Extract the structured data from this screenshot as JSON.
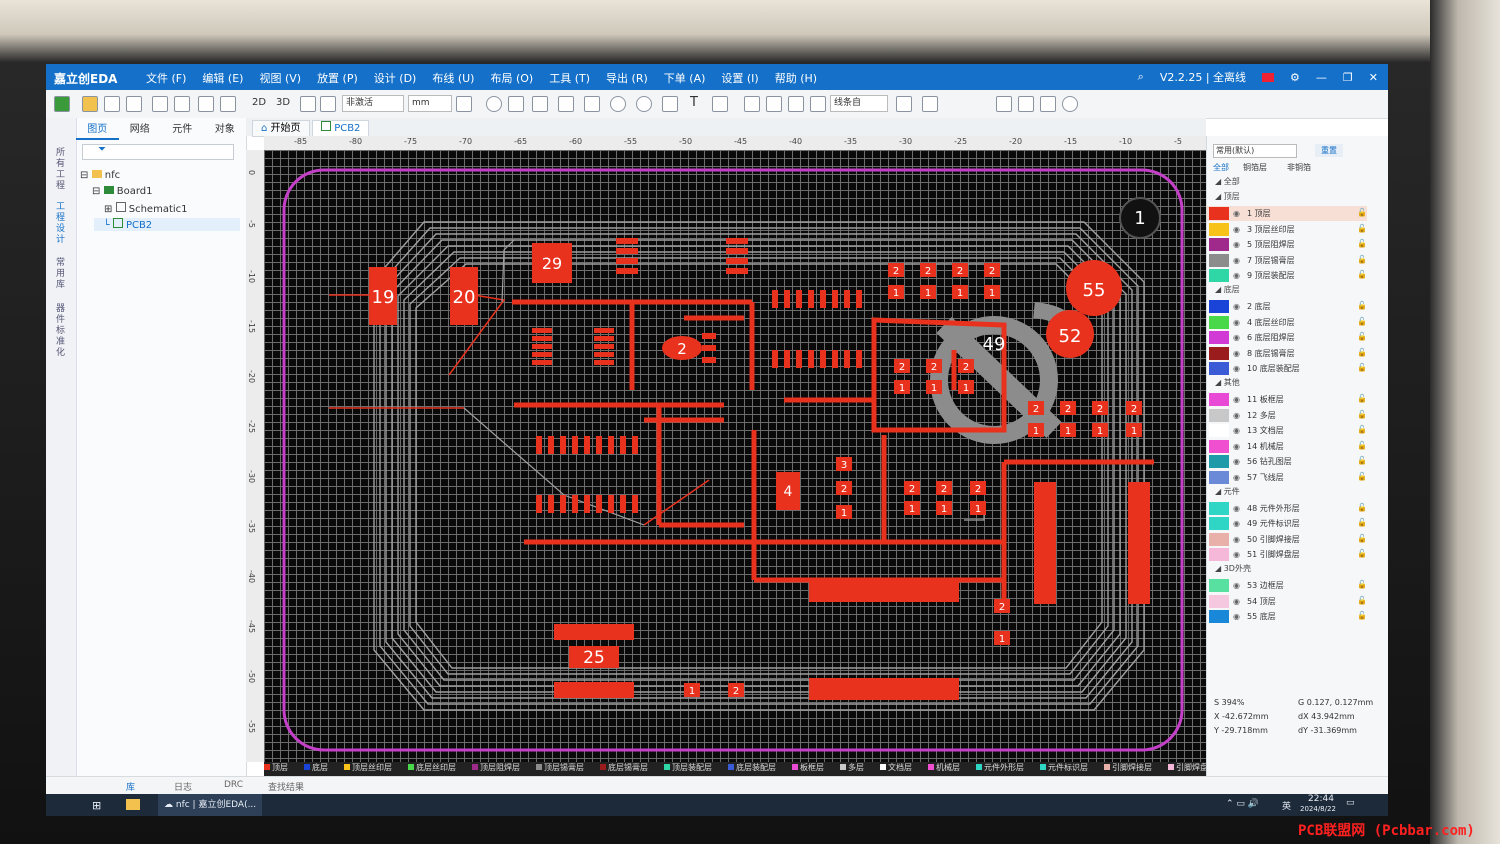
{
  "app": {
    "logo_text": "嘉立创EDA",
    "version": "V2.2.25 | 全离线",
    "menus": [
      "文件 (F)",
      "编辑 (E)",
      "视图 (V)",
      "放置 (P)",
      "设计 (D)",
      "布线 (U)",
      "布局 (O)",
      "工具 (T)",
      "导出 (R)",
      "下单 (A)",
      "设置 (I)",
      "帮助 (H)"
    ]
  },
  "toolbar": {
    "view_2d": "2D",
    "view_3d": "3D",
    "mode_select": "非激活",
    "unit_select": "mm",
    "line_mode_select": "线条自"
  },
  "left_panel": {
    "vertical_tabs": [
      "所有工程",
      "工程设计",
      "常用库",
      "器件标准化"
    ],
    "tabs": [
      "图页",
      "网络",
      "元件",
      "对象"
    ],
    "tree": [
      "nfc",
      "Board1",
      "Schematic1",
      "PCB2"
    ]
  },
  "doc_tabs": [
    "开始页",
    "PCB2"
  ],
  "ruler_h": [
    "-85",
    "-80",
    "-75",
    "-70",
    "-65",
    "-60",
    "-55",
    "-50",
    "-45",
    "-40",
    "-35",
    "-30",
    "-25",
    "-20",
    "-15",
    "-10",
    "-5"
  ],
  "ruler_v": [
    "0",
    "-5",
    "-10",
    "-15",
    "-20",
    "-25",
    "-30",
    "-35",
    "-40",
    "-45",
    "-50",
    "-55"
  ],
  "pcb": {
    "designators": [
      "1",
      "19",
      "20",
      "29",
      "2",
      "55",
      "52",
      "49",
      "4",
      "25"
    ],
    "pad_numbers": [
      "2",
      "1",
      "3"
    ]
  },
  "layer_bar": [
    "顶层",
    "底层",
    "顶层丝印层",
    "底层丝印层",
    "顶层阻焊层",
    "顶层锡膏层",
    "底层锡膏层",
    "顶层装配层",
    "底层装配层",
    "板框层",
    "多层",
    "文档层",
    "机械层",
    "元件外形层",
    "元件标识层",
    "引脚焊接层",
    "引脚焊盘层",
    "3D外壳"
  ],
  "right_panel": {
    "preset_select": "常用(默认)",
    "reset_button": "重置",
    "filter_tabs": [
      "全部",
      "铜箔层",
      "非铜箔"
    ],
    "groups": [
      "全部",
      "顶层",
      "底层",
      "其他",
      "元件",
      "3D外壳"
    ],
    "layers": [
      {
        "name": "1 顶层",
        "color": "#e8321e"
      },
      {
        "name": "3 顶层丝印层",
        "color": "#f7c21a"
      },
      {
        "name": "5 顶层阻焊层",
        "color": "#a02a8c"
      },
      {
        "name": "7 顶层锡膏层",
        "color": "#8c8c8c"
      },
      {
        "name": "9 顶层装配层",
        "color": "#2fd6a6"
      },
      {
        "name": "2 底层",
        "color": "#1a44d8"
      },
      {
        "name": "4 底层丝印层",
        "color": "#48d84a"
      },
      {
        "name": "6 底层阻焊层",
        "color": "#d23ad6"
      },
      {
        "name": "8 底层锡膏层",
        "color": "#9a1c1c"
      },
      {
        "name": "10 底层装配层",
        "color": "#3a5ad6"
      },
      {
        "name": "11 板框层",
        "color": "#e84ad6"
      },
      {
        "name": "12 多层",
        "color": "#c8c8c8"
      },
      {
        "name": "13 文档层",
        "color": "#ffffff"
      },
      {
        "name": "14 机械层",
        "color": "#f050d0"
      },
      {
        "name": "56 钻孔图层",
        "color": "#1e9aa8"
      },
      {
        "name": "57 飞线层",
        "color": "#6a8ad8"
      },
      {
        "name": "48 元件外形层",
        "color": "#2fd6c6"
      },
      {
        "name": "49 元件标识层",
        "color": "#2fd6c6"
      },
      {
        "name": "50 引脚焊接层",
        "color": "#e8b0a8"
      },
      {
        "name": "51 引脚焊盘层",
        "color": "#f6b8d8"
      },
      {
        "name": "53 边框层",
        "color": "#58e0a0"
      },
      {
        "name": "54 顶层",
        "color": "#f6c8e0"
      },
      {
        "name": "55 底层",
        "color": "#1a88d8"
      }
    ],
    "coords": {
      "s": "S  394%",
      "x": "X  -42.672mm",
      "y": "Y  -29.718mm",
      "g": "G  0.127, 0.127mm",
      "dx": "dX  43.942mm",
      "dy": "dY  -31.369mm"
    }
  },
  "status_tabs": [
    "库",
    "日志",
    "DRC",
    "查找结果"
  ],
  "taskbar": {
    "app_item": "nfc | 嘉立创EDA(...",
    "ime": "英",
    "time": "22:44",
    "date": "2024/8/22"
  },
  "watermark": "PCB联盟网 (Pcbbar.com)",
  "colors": {
    "titlebar": "#1470c8",
    "copper": "#e8321e",
    "board_outline": "#c540c8",
    "trace_gray": "#9a9a9a"
  }
}
